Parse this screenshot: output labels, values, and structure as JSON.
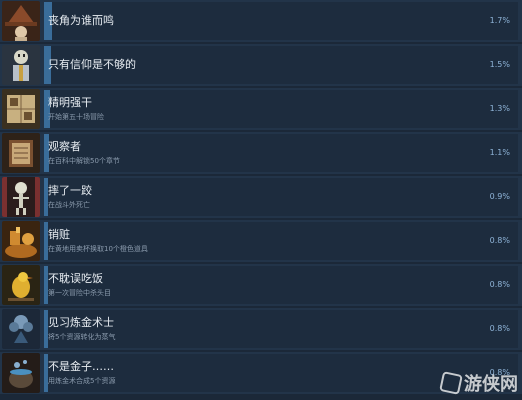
{
  "achievements": [
    {
      "title": "丧角为谁而鸣",
      "description": "",
      "percent": "1.7%",
      "fill": 0.017,
      "icon": "witch-hat-icon",
      "color": "#8a4a2a"
    },
    {
      "title": "只有信仰是不够的",
      "description": "",
      "percent": "1.5%",
      "fill": 0.015,
      "icon": "skeleton-priest-icon",
      "color": "#6b7f8f"
    },
    {
      "title": "精明强干",
      "description": "开始第五十场冒险",
      "percent": "1.3%",
      "fill": 0.013,
      "icon": "treasure-map-icon",
      "color": "#8a7a5a"
    },
    {
      "title": "观察者",
      "description": "在百科中解锁50个章节",
      "percent": "1.1%",
      "fill": 0.011,
      "icon": "book-icon",
      "color": "#6a4a30"
    },
    {
      "title": "摔了一跤",
      "description": "在战斗外死亡",
      "percent": "0.9%",
      "fill": 0.009,
      "icon": "skeleton-icon",
      "color": "#5a3030"
    },
    {
      "title": "销赃",
      "description": "在黄地用卖杯换取10个橙色道具",
      "percent": "0.8%",
      "fill": 0.008,
      "icon": "loot-pile-icon",
      "color": "#b06a20"
    },
    {
      "title": "不耽误吃饭",
      "description": "第一次冒险中杀头目",
      "percent": "0.8%",
      "fill": 0.008,
      "icon": "golden-bird-icon",
      "color": "#c09020"
    },
    {
      "title": "见习炼金术士",
      "description": "将5个资源转化为蒸气",
      "percent": "0.8%",
      "fill": 0.008,
      "icon": "alchemy-smoke-icon",
      "color": "#3a5a7a"
    },
    {
      "title": "不是金子……",
      "description": "用炼金术合成5个资源",
      "percent": "0.8%",
      "fill": 0.008,
      "icon": "cauldron-icon",
      "color": "#5a4a3a"
    }
  ],
  "watermark": {
    "text": "游侠网"
  }
}
